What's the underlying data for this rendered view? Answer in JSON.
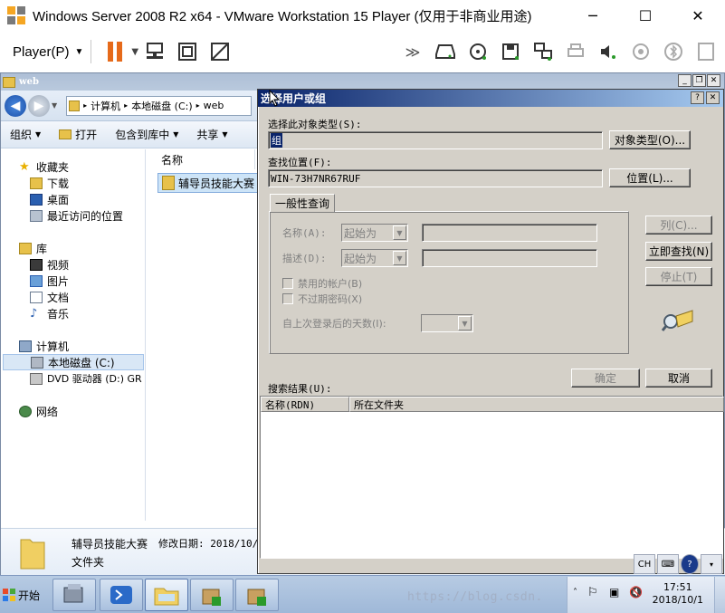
{
  "vm": {
    "title": "Windows Server 2008 R2 x64 - VMware Workstation 15 Player (仅用于非商业用途)",
    "player_menu": "Player(P)",
    "minimize_glyph": "─",
    "maximize_glyph": "☐",
    "close_glyph": "✕"
  },
  "explorer": {
    "title": "web",
    "address": {
      "segments": [
        "计算机",
        "本地磁盘 (C:)",
        "web"
      ]
    },
    "commands": [
      "组织",
      "打开",
      "包含到库中",
      "共享"
    ],
    "nav": {
      "favorites": "收藏夹",
      "downloads": "下载",
      "desktop": "桌面",
      "recent": "最近访问的位置",
      "libraries": "库",
      "videos": "视频",
      "pictures": "图片",
      "documents": "文档",
      "music": "音乐",
      "computer": "计算机",
      "local_disk": "本地磁盘 (C:)",
      "dvd": "DVD 驱动器 (D:) GR",
      "network": "网络"
    },
    "column_name": "名称",
    "file_name": "辅导员技能大赛",
    "details": {
      "name": "辅导员技能大赛",
      "modified": "修改日期: 2018/10/",
      "type": "文件夹"
    }
  },
  "dialog": {
    "title": "选择用户或组",
    "help_glyph": "?",
    "close_glyph": "✕",
    "object_type_label": "选择此对象类型(S):",
    "object_type_value": "组",
    "object_type_button": "对象类型(O)...",
    "location_label": "查找位置(F):",
    "location_value": "WIN-73H7NR67RUF",
    "location_button": "位置(L)...",
    "tab_label": "一般性查询",
    "name_label": "名称(A):",
    "name_combo": "起始为",
    "desc_label": "描述(D):",
    "desc_combo": "起始为",
    "disabled_accounts": "禁用的帐户(B)",
    "no_expire": "不过期密码(X)",
    "days_label": "自上次登录后的天数(I):",
    "columns_button": "列(C)...",
    "find_now_button": "立即查找(N)",
    "stop_button": "停止(T)",
    "ok_button": "确定",
    "cancel_button": "取消",
    "results_label": "搜索结果(U):",
    "results_col_name": "名称(RDN)",
    "results_col_folder": "所在文件夹"
  },
  "taskbar": {
    "start": "开始",
    "clock_time": "17:51",
    "clock_date": "2018/10/1",
    "lang": "CH"
  },
  "watermark": "https://blog.csdn.",
  "colors": {
    "accent_orange": "#e66a1a",
    "dialog_title_start": "#0a246a",
    "dialog_title_end": "#a6caf0"
  }
}
